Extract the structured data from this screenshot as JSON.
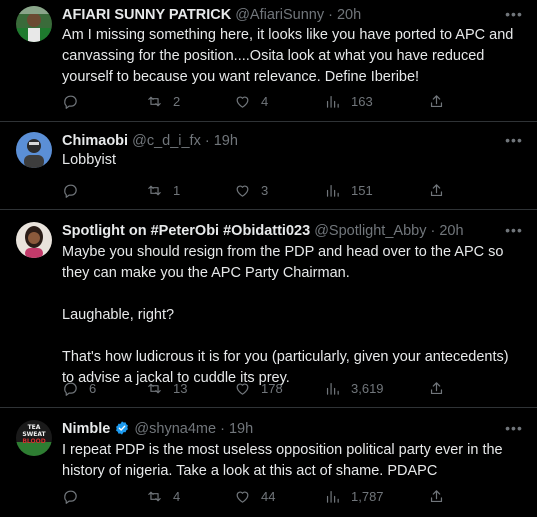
{
  "colors": {
    "background": "#000000",
    "text": "#e7e9ea",
    "muted": "#71767b",
    "divider": "#2f3336",
    "verified": "#1d9bf0"
  },
  "tweets": [
    {
      "name": "AFIARI SUNNY PATRICK",
      "handle": "@AfiariSunny",
      "dot": "·",
      "time": "20h",
      "text": [
        "Am I missing something here, it looks like you have ported to APC and canvassing for the position....Osita look at what you have reduced yourself to because you want relevance. Define Iberibe!"
      ],
      "replies": "",
      "retweets": "2",
      "likes": "4",
      "views": "163",
      "avatar_icon": "profile-photo"
    },
    {
      "name": "Chimaobi",
      "handle": "@c_d_i_fx",
      "dot": "·",
      "time": "19h",
      "text": [
        "Lobbyist"
      ],
      "replies": "",
      "retweets": "1",
      "likes": "3",
      "views": "151",
      "avatar_icon": "profile-photo"
    },
    {
      "name": "Spotlight on #PeterObi #Obidatti023",
      "handle": "@Spotlight_Abby",
      "dot": "·",
      "time": "20h",
      "text": [
        "Maybe you should resign from the PDP and head over to the APC so they can make you the APC Party Chairman.",
        "Laughable, right?",
        "That's how ludicrous it is for you (particularly, given your antecedents) to advise a jackal to cuddle its prey."
      ],
      "replies": "6",
      "retweets": "13",
      "likes": "178",
      "views": "3,619",
      "avatar_icon": "profile-photo"
    },
    {
      "name": "Nimble",
      "handle": "@shyna4me",
      "dot": "·",
      "time": "19h",
      "verified": true,
      "text": [
        "I repeat PDP is the most useless opposition political party ever in the history of nigeria. Take a look at this act of shame. PDAPC"
      ],
      "replies": "",
      "retweets": "4",
      "likes": "44",
      "views": "1,787",
      "avatar_icon": "profile-photo",
      "avatar_text": [
        "TEA",
        "SWEAT",
        "BLOOD"
      ]
    }
  ],
  "icons": {
    "more": "more-dots-icon",
    "reply": "reply-icon",
    "retweet": "retweet-icon",
    "like": "heart-icon",
    "views": "views-icon",
    "share": "share-icon",
    "verified": "verified-badge-icon"
  }
}
